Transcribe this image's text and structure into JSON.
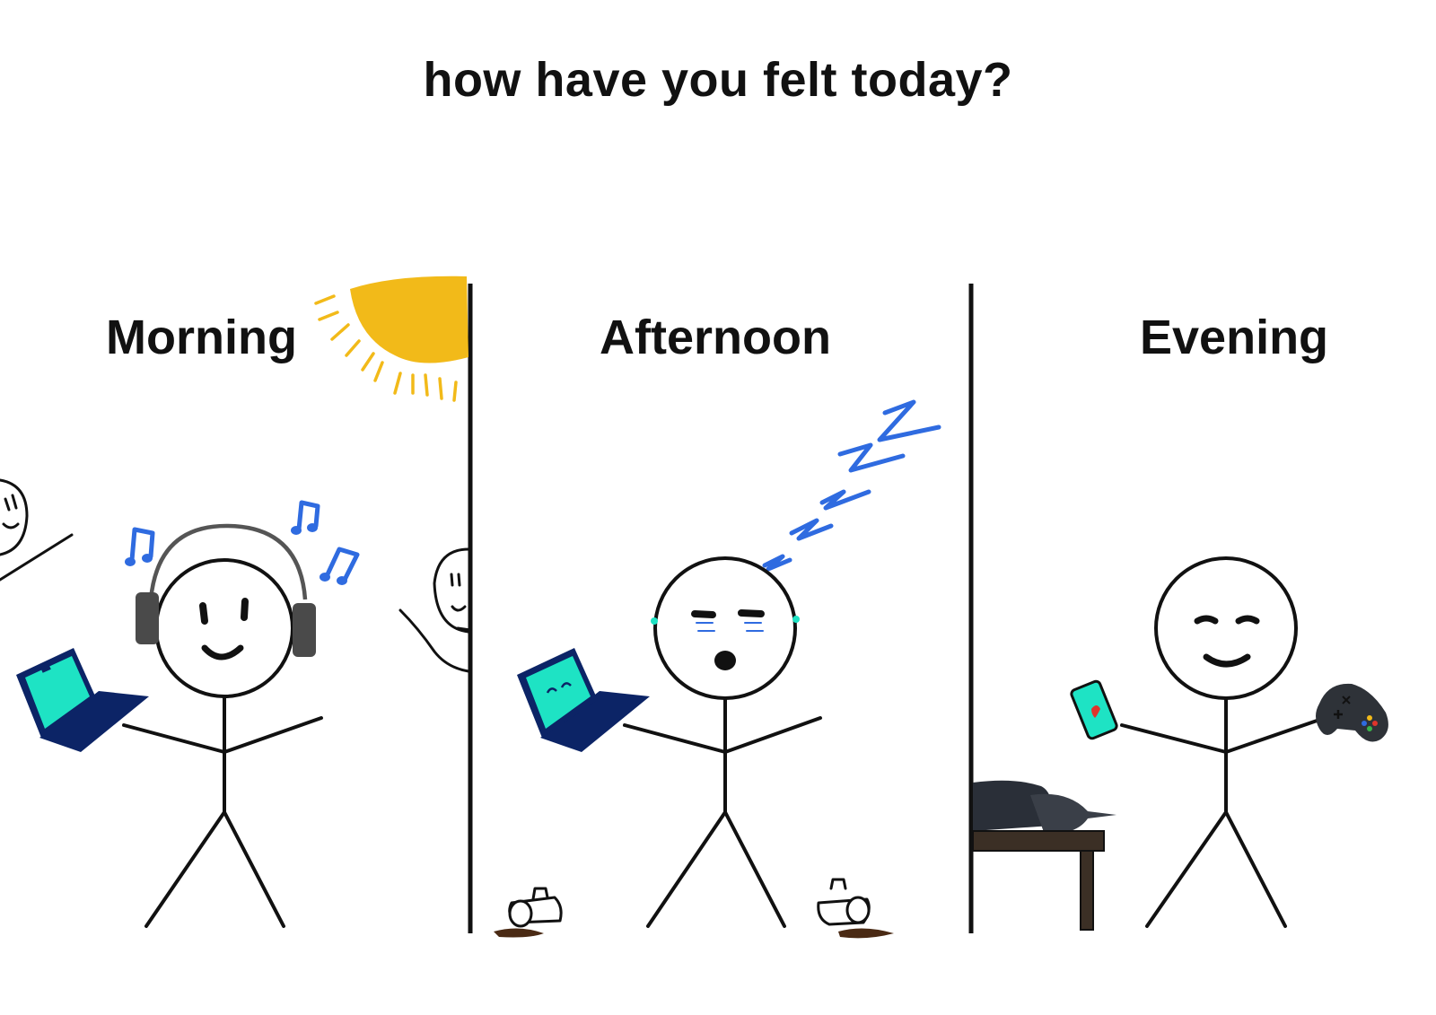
{
  "title": "how have you felt today?",
  "panels": [
    {
      "label": "Morning"
    },
    {
      "label": "Afternoon"
    },
    {
      "label": "Evening"
    }
  ],
  "colors": {
    "ink": "#111111",
    "sun": "#F2BA19",
    "screen": "#1EE3C4",
    "laptop": "#0C2466",
    "music": "#2F6BE0",
    "coffee": "#4A2A14",
    "pillow": "#2A2F38",
    "bed": "#3B2F25",
    "card_heart": "#E0342B"
  },
  "icons": [
    "sun-icon",
    "music-note-icon",
    "laptop-icon",
    "headphones-icon",
    "zzz-icon",
    "coffee-cup-icon",
    "phone-icon",
    "game-controller-icon",
    "bed-icon"
  ]
}
